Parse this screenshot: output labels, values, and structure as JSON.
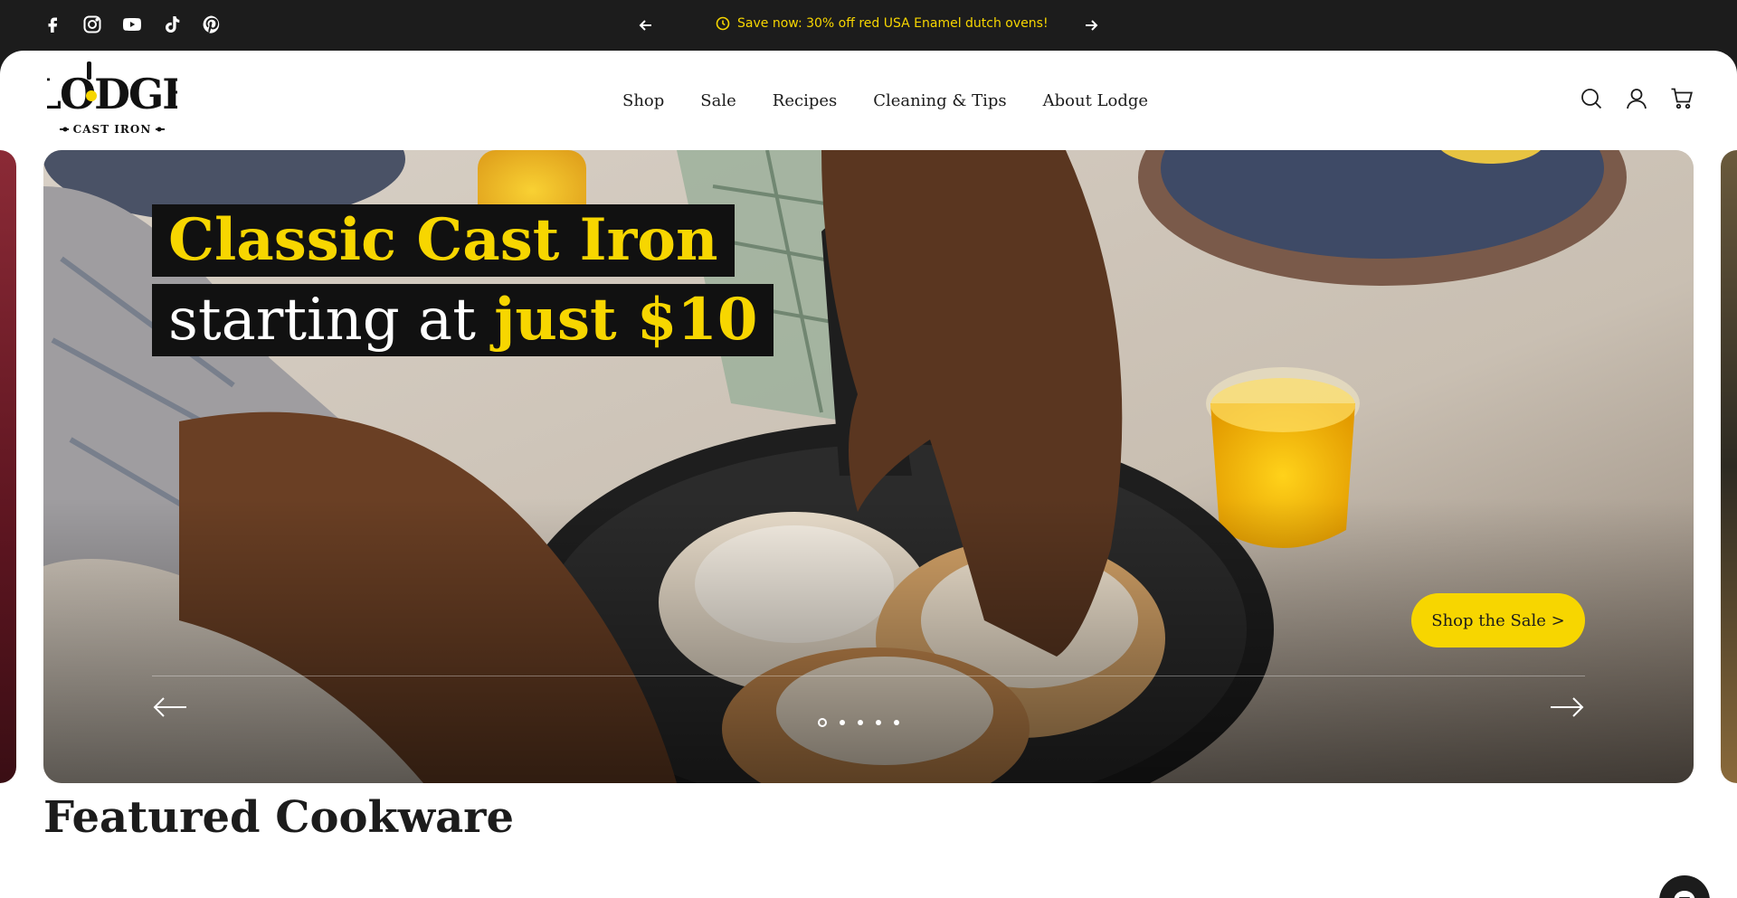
{
  "announcement": {
    "text": "Save now: 30% off red USA Enamel dutch ovens!",
    "prev_icon": "arrow-left-icon",
    "next_icon": "arrow-right-icon",
    "clock_icon": "clock-icon"
  },
  "social": [
    "facebook-icon",
    "instagram-icon",
    "youtube-icon",
    "tiktok-icon",
    "pinterest-icon"
  ],
  "brand": {
    "name": "LODGE",
    "tagline": "CAST IRON"
  },
  "nav": {
    "items": [
      {
        "label": "Shop"
      },
      {
        "label": "Sale"
      },
      {
        "label": "Recipes"
      },
      {
        "label": "Cleaning & Tips"
      },
      {
        "label": "About Lodge"
      }
    ]
  },
  "header_icons": [
    "search-icon",
    "account-icon",
    "cart-icon"
  ],
  "hero": {
    "headline_line1": "Classic Cast Iron",
    "headline_line2_prefix": "starting at ",
    "headline_line2_highlight": "just $10",
    "cta_label": "Shop the Sale >",
    "slide_count": 5,
    "active_slide": 1
  },
  "featured": {
    "title": "Featured Cookware"
  },
  "colors": {
    "accent": "#f7d600",
    "dark": "#1c1c1c",
    "white": "#ffffff"
  }
}
